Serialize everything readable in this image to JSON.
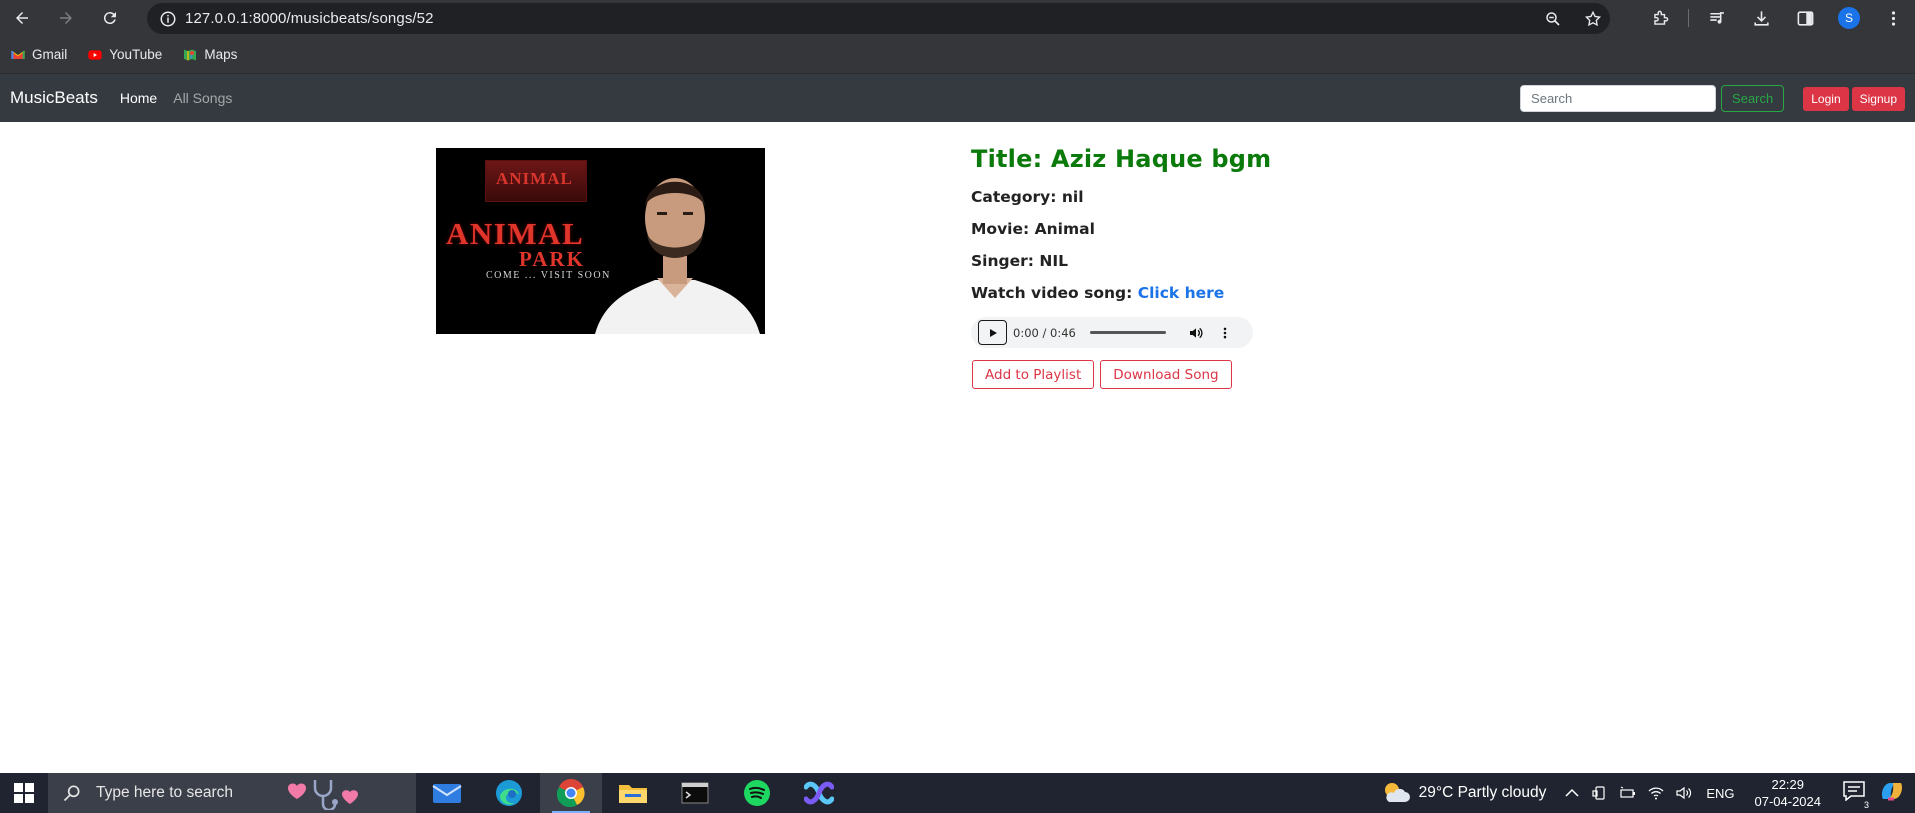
{
  "browser": {
    "url": "127.0.0.1:8000/musicbeats/songs/52",
    "profile_initial": "S",
    "bookmarks": [
      {
        "label": "Gmail",
        "icon": "gmail-icon"
      },
      {
        "label": "YouTube",
        "icon": "youtube-icon"
      },
      {
        "label": "Maps",
        "icon": "maps-icon"
      }
    ]
  },
  "navbar": {
    "brand": "MusicBeats",
    "links": [
      {
        "label": "Home",
        "active": true
      },
      {
        "label": "All Songs",
        "active": false
      }
    ],
    "search_placeholder": "Search",
    "search_button": "Search",
    "login_button": "Login",
    "signup_button": "Signup"
  },
  "cover": {
    "poster_title": "ANIMAL",
    "title": "ANIMAL",
    "subtitle": "PARK",
    "tagline": "COME ... VISIT SOON"
  },
  "song": {
    "title": "Title: Aziz Haque bgm",
    "category_label": "Category: ",
    "category": "nil",
    "movie_label": "Movie: ",
    "movie": "Animal",
    "singer_label": "Singer: ",
    "singer": "NIL",
    "video_label": "Watch video song: ",
    "video_link": "Click here"
  },
  "player": {
    "time": "0:00 / 0:46",
    "progress": 0
  },
  "actions": {
    "add_to_playlist": "Add to Playlist",
    "download": "Download Song"
  },
  "taskbar": {
    "search_placeholder": "Type here to search",
    "weather": "29°C  Partly cloudy",
    "language": "ENG",
    "time": "22:29",
    "date": "07-04-2024",
    "notification_count": "3"
  },
  "colors": {
    "title_green": "#0a7a0a",
    "navbar_bg": "#343a40",
    "danger": "#dc3545",
    "success": "#28a745",
    "link_blue": "#1a73e8"
  }
}
